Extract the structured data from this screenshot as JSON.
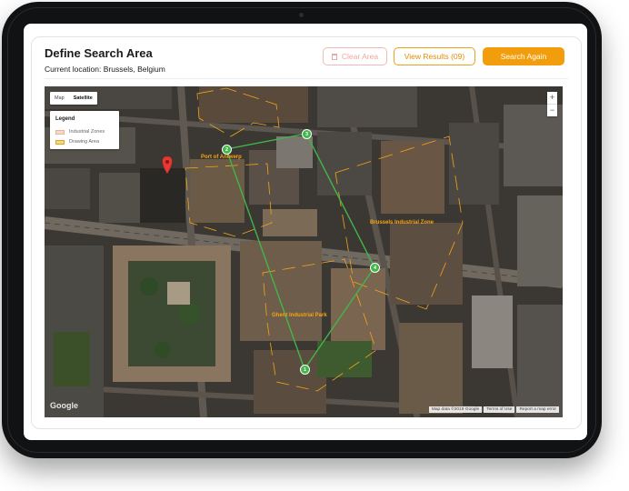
{
  "header": {
    "title": "Define Search Area",
    "location_label": "Current location:",
    "location_value": "Brussels, Belgium"
  },
  "toolbar": {
    "clear_label": "Clear Area",
    "view_label": "View Results (09)",
    "search_label": "Search Again"
  },
  "map": {
    "type_options": [
      "Map",
      "Satellite"
    ],
    "type_selected": "Satellite",
    "legend": {
      "title": "Legend",
      "items": [
        {
          "label": "Industrial Zones",
          "color": "#f8d8c8"
        },
        {
          "label": "Drawing Area",
          "color": "#f5d77e"
        }
      ]
    },
    "zoom_in": "+",
    "zoom_out": "−",
    "zones": [
      "Port of Antwerp",
      "Brussels Industrial Zone",
      "Ghent Industrial Park"
    ],
    "vertices": [
      "1",
      "2",
      "3",
      "4"
    ],
    "google_logo": "Google",
    "attribution": [
      "Map data ©2019 Google",
      "Terms of Use",
      "Report a map error"
    ]
  },
  "colors": {
    "accent": "#f29d0c",
    "polygon": "#41b649",
    "zone_outline": "#f4a517",
    "marker": "#e53935"
  }
}
